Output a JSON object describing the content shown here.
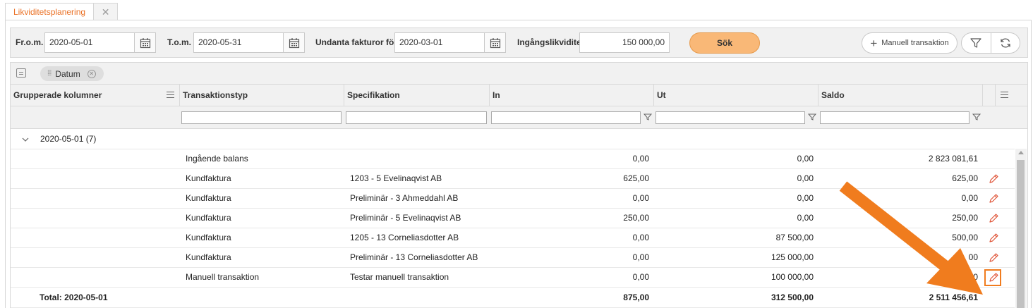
{
  "tab": {
    "label": "Likviditetsplanering",
    "close": "✕"
  },
  "filters": {
    "from_label": "Fr.o.m.",
    "from_value": "2020-05-01",
    "to_label": "T.o.m.",
    "to_value": "2020-05-31",
    "exclude_label": "Undanta fakturor före",
    "exclude_value": "2020-03-01",
    "opening_label": "Ingångslikviditet",
    "opening_value": "150 000,00",
    "search_label": "Sök",
    "manual_label": "Manuell transaktion"
  },
  "group_chip": {
    "label": "Datum"
  },
  "columns": {
    "grouped": "Grupperade kolumner",
    "type": "Transaktionstyp",
    "spec": "Specifikation",
    "in": "In",
    "out": "Ut",
    "balance": "Saldo"
  },
  "group": {
    "label": "2020-05-01 (7)"
  },
  "rows": [
    {
      "type": "Ingående balans",
      "spec": "",
      "in": "0,00",
      "out": "0,00",
      "balance": "2 823 081,61",
      "editable": false
    },
    {
      "type": "Kundfaktura",
      "spec": "1203 - 5 Evelinaqvist AB",
      "in": "625,00",
      "out": "0,00",
      "balance": "625,00",
      "editable": true
    },
    {
      "type": "Kundfaktura",
      "spec": "Preliminär - 3 Ahmeddahl AB",
      "in": "0,00",
      "out": "0,00",
      "balance": "0,00",
      "editable": true
    },
    {
      "type": "Kundfaktura",
      "spec": "Preliminär - 5 Evelinaqvist AB",
      "in": "250,00",
      "out": "0,00",
      "balance": "250,00",
      "editable": true
    },
    {
      "type": "Kundfaktura",
      "spec": "1205 - 13 Corneliasdotter AB",
      "in": "0,00",
      "out": "87 500,00",
      "balance": "500,00",
      "editable": true
    },
    {
      "type": "Kundfaktura",
      "spec": "Preliminär - 13 Corneliasdotter AB",
      "in": "0,00",
      "out": "125 000,00",
      "balance": "00",
      "editable": true
    },
    {
      "type": "Manuell transaktion",
      "spec": "Testar manuell transaktion",
      "in": "0,00",
      "out": "100 000,00",
      "balance": "-100 000,00",
      "editable": true
    }
  ],
  "total": {
    "label": "Total: 2020-05-01",
    "in": "875,00",
    "out": "312 500,00",
    "balance": "2 511 456,61"
  },
  "colors": {
    "accent": "#ea7024",
    "search_button": "#f9b877",
    "arrow": "#f07c1e",
    "edit_icon": "#e0563a"
  },
  "icons": [
    "calendar-icon",
    "plus-icon",
    "filter-icon",
    "refresh-icon",
    "group-panel-icon",
    "drag-grip-icon",
    "remove-chip-icon",
    "column-menu-icon",
    "funnel-icon",
    "chevron-down-icon",
    "pencil-icon",
    "arrow-annotation"
  ]
}
